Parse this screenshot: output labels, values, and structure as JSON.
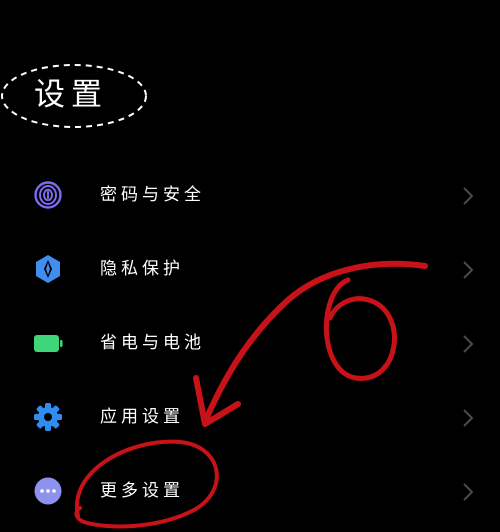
{
  "header": {
    "title": "设置"
  },
  "settings": {
    "items": [
      {
        "label": "密码与安全",
        "icon": "fingerprint-icon",
        "color": "#7a6cf0"
      },
      {
        "label": "隐私保护",
        "icon": "privacy-shield-icon",
        "color": "#3f8ef0"
      },
      {
        "label": "省电与电池",
        "icon": "battery-icon",
        "color": "#3fd67a"
      },
      {
        "label": "应用设置",
        "icon": "gear-icon",
        "color": "#2f8cf0"
      },
      {
        "label": "更多设置",
        "icon": "more-dots-icon",
        "color": "#8c92ee"
      }
    ]
  },
  "colors": {
    "background": "#000000",
    "annotation": "#c8121a",
    "chevron": "#4a4a4a"
  }
}
